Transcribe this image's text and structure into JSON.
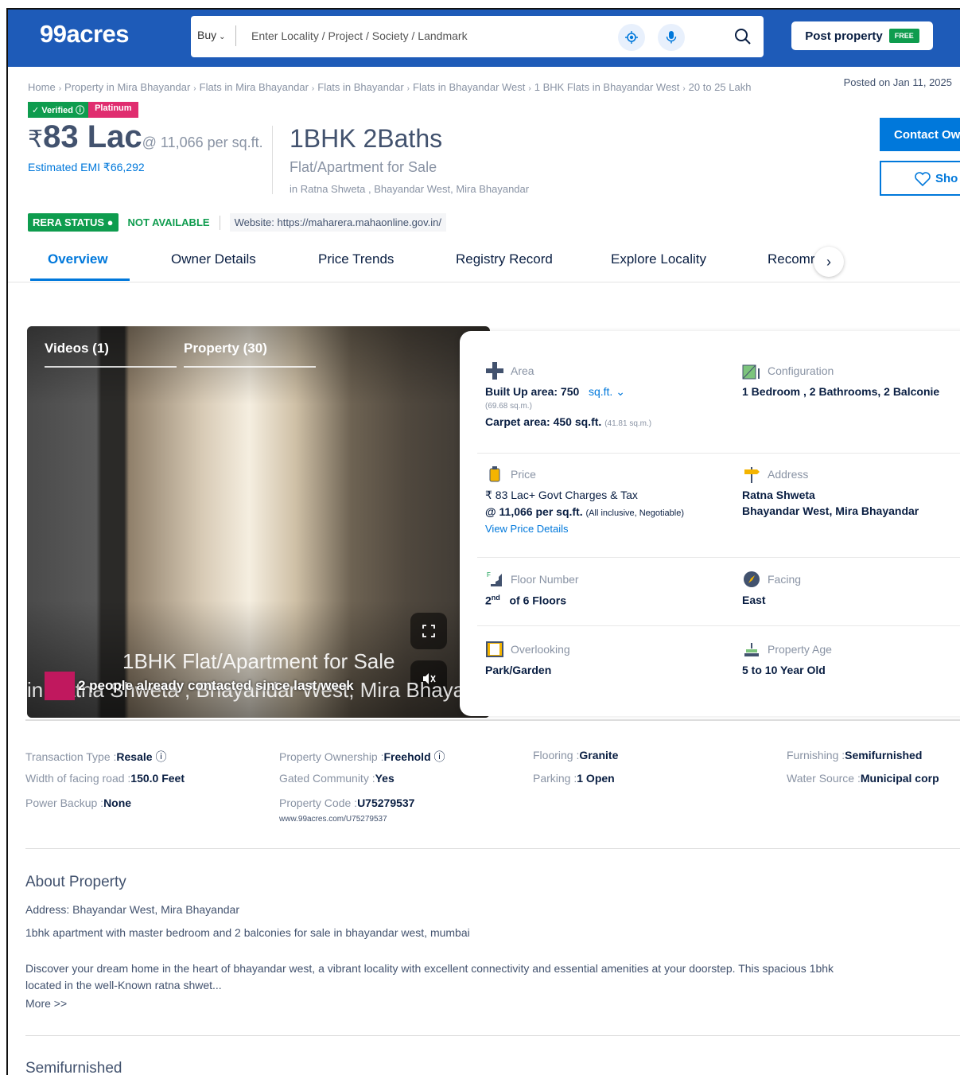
{
  "header": {
    "logo": "99acres",
    "buy_label": "Buy",
    "search_placeholder": "Enter Locality / Project / Society / Landmark",
    "post_property": "Post property",
    "free_badge": "FREE"
  },
  "breadcrumb": [
    "Home",
    "Property in Mira Bhayandar",
    "Flats in Mira Bhayandar",
    "Flats in Bhayandar",
    "Flats in Bhayandar West",
    "1 BHK Flats in Bhayandar West",
    "20 to 25 Lakh"
  ],
  "posted_on": "Posted on Jan 11, 2025",
  "badges": {
    "verified": "Verified",
    "platinum": "Platinum"
  },
  "price": {
    "currency": "₹",
    "amount": "83 Lac",
    "per_sqft": "@ 11,066 per sq.ft.",
    "emi": "Estimated EMI ₹66,292"
  },
  "listing": {
    "title": "1BHK 2Baths",
    "subtitle": "Flat/Apartment for Sale",
    "location": "in Ratna Shweta , Bhayandar West, Mira Bhayandar"
  },
  "actions": {
    "contact": "Contact Ow",
    "shortlist": "Sho"
  },
  "rera": {
    "status": "RERA STATUS",
    "value": "NOT AVAILABLE",
    "website": "Website: https://maharera.mahaonline.gov.in/"
  },
  "tabs": [
    "Overview",
    "Owner Details",
    "Price Trends",
    "Registry Record",
    "Explore Locality",
    "Recomr"
  ],
  "media": {
    "videos_tab": "Videos (1)",
    "property_tab": "Property (30)",
    "caption_line1": "1BHK Flat/Apartment for Sale",
    "caption_line2": "in Ratna Shweta , Bhayandar West, Mira Bhayan",
    "contacted": "2 people already contacted since last week"
  },
  "details": {
    "area": {
      "label": "Area",
      "built_up": "Built Up area: 750",
      "unit": "sq.ft.",
      "built_up_sqm": "(69.68 sq.m.)",
      "carpet": "Carpet area: 450 sq.ft.",
      "carpet_sqm": "(41.81 sq.m.)"
    },
    "configuration": {
      "label": "Configuration",
      "value": "1 Bedroom , 2 Bathrooms, 2 Balconie"
    },
    "price": {
      "label": "Price",
      "line1": "₹ 83 Lac+ Govt Charges & Tax",
      "line2": "@ 11,066 per sq.ft.",
      "line2_note": "(All inclusive, Negotiable)",
      "link": "View Price Details"
    },
    "address": {
      "label": "Address",
      "line1": "Ratna Shweta",
      "line2": "Bhayandar West, Mira Bhayandar"
    },
    "floor": {
      "label": "Floor Number",
      "floor": "2",
      "sup": "nd",
      "of": "of 6 Floors"
    },
    "facing": {
      "label": "Facing",
      "value": "East"
    },
    "overlooking": {
      "label": "Overlooking",
      "value": "Park/Garden"
    },
    "age": {
      "label": "Property Age",
      "value": "5 to 10 Year Old"
    }
  },
  "info": {
    "transaction_label": "Transaction Type :",
    "transaction": "Resale",
    "ownership_label": "Property Ownership :",
    "ownership": "Freehold",
    "flooring_label": "Flooring :",
    "flooring": "Granite",
    "furnishing_label": "Furnishing :",
    "furnishing": "Semifurnished",
    "road_label": "Width of facing road :",
    "road": "150.0 Feet",
    "gated_label": "Gated Community :",
    "gated": "Yes",
    "parking_label": "Parking :",
    "parking": "1 Open",
    "water_label": "Water Source :",
    "water": "Municipal corp",
    "power_label": "Power Backup :",
    "power": "None",
    "code_label": "Property Code :",
    "code": "U75279537",
    "code_url": "www.99acres.com/U75279537"
  },
  "about": {
    "title": "About Property",
    "address": "Address: Bhayandar West, Mira Bhayandar",
    "line1": "1bhk apartment with master bedroom and 2 balconies for sale in bhayandar west, mumbai",
    "desc1": "Discover your dream home in the heart of bhayandar west, a vibrant locality with excellent connectivity and essential amenities at your doorstep. This spacious 1bhk",
    "desc2": "located in the well-Known ratna shwet...",
    "more": "More >>"
  },
  "semi_title": "Semifurnished",
  "colors": {
    "brand": "#1e5bb8",
    "accent": "#0078db",
    "green": "#0e9c4e",
    "pink": "#e02d6f"
  }
}
